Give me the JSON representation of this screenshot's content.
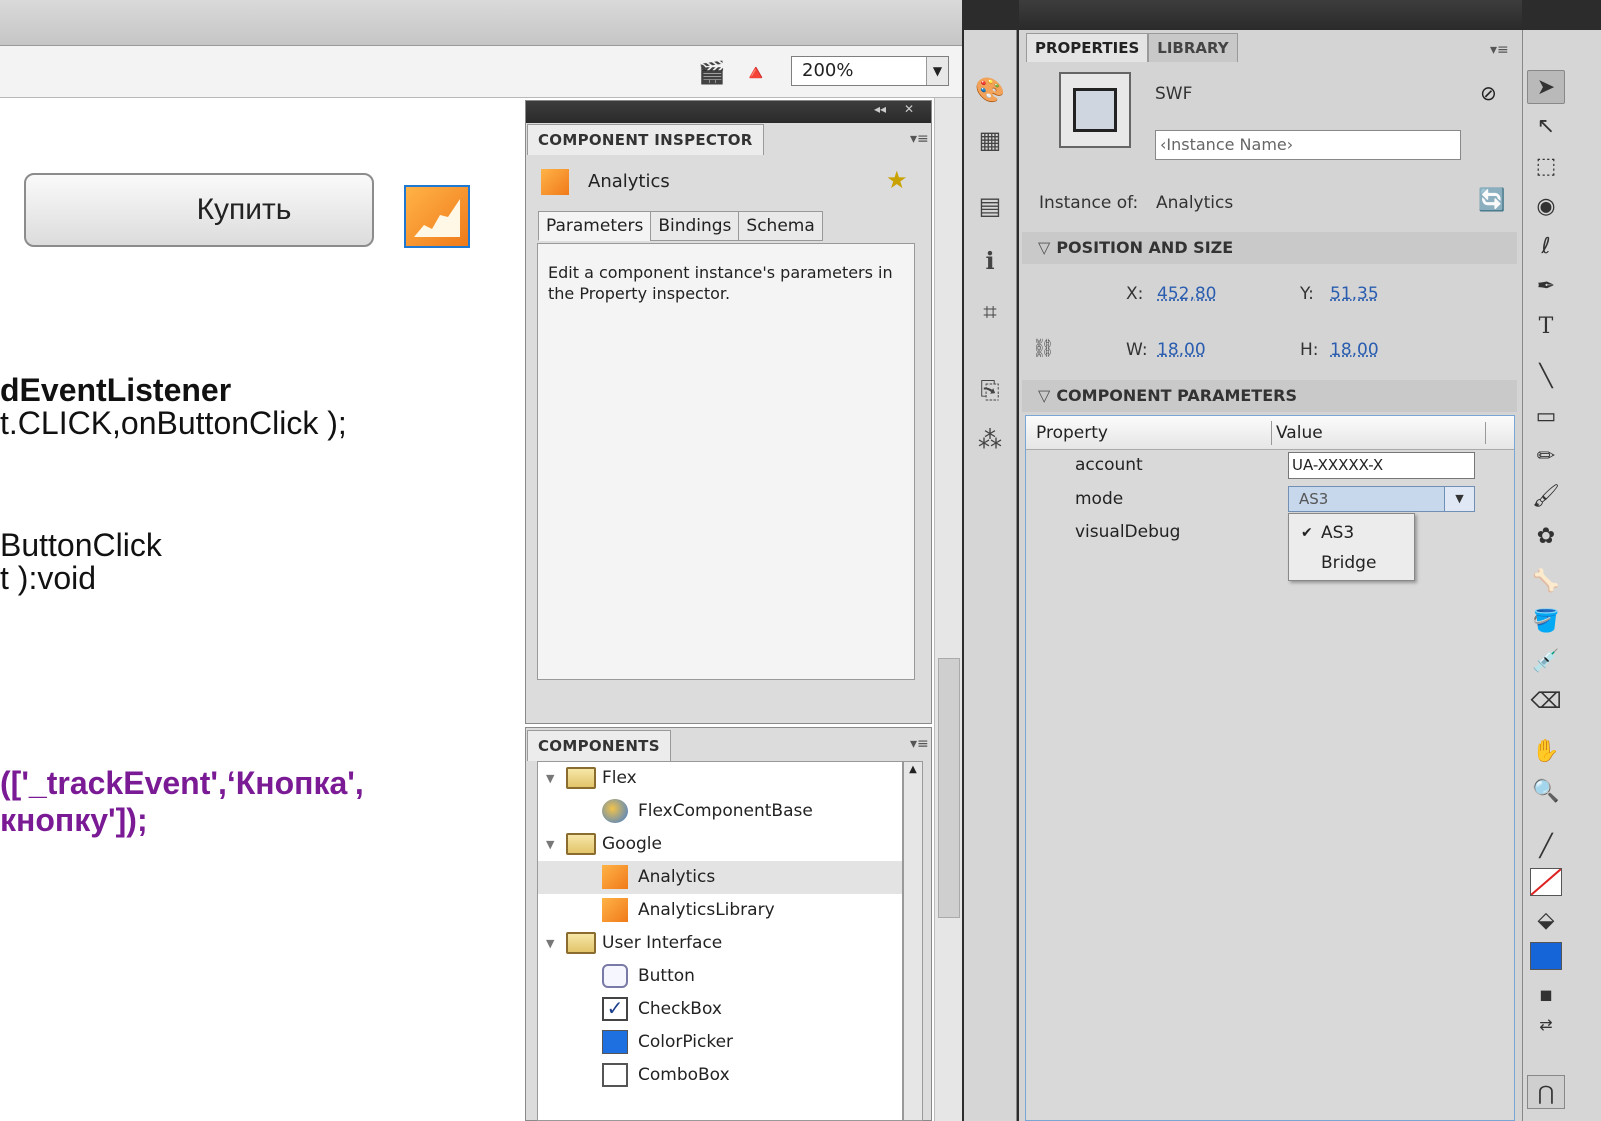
{
  "toolbar": {
    "zoom_value": "200%"
  },
  "stage": {
    "buy_button_label": "Купить",
    "code_lines": [
      "dEventListener",
      "t.CLICK,onButtonClick );",
      "ButtonClick",
      "t ):void",
      "(['_trackEvent',‘Кнопка',",
      "кнопку']);"
    ]
  },
  "component_inspector": {
    "title": "COMPONENT INSPECTOR",
    "component_name": "Analytics",
    "tabs": [
      "Parameters",
      "Bindings",
      "Schema"
    ],
    "body_text": "Edit a component instance's parameters in the Property inspector."
  },
  "components": {
    "title": "COMPONENTS",
    "tree": [
      {
        "label": "Flex",
        "type": "folder"
      },
      {
        "label": "FlexComponentBase",
        "type": "flex"
      },
      {
        "label": "Google",
        "type": "folder"
      },
      {
        "label": "Analytics",
        "type": "orange"
      },
      {
        "label": "AnalyticsLibrary",
        "type": "orange"
      },
      {
        "label": "User Interface",
        "type": "folder"
      },
      {
        "label": "Button",
        "type": "button"
      },
      {
        "label": "CheckBox",
        "type": "check"
      },
      {
        "label": "ColorPicker",
        "type": "color"
      },
      {
        "label": "ComboBox",
        "type": "combo"
      }
    ]
  },
  "properties": {
    "tabs": [
      "PROPERTIES",
      "LIBRARY"
    ],
    "symbol_type": "SWF",
    "instance_name_placeholder": "‹Instance Name›",
    "instance_of_label": "Instance of:",
    "instance_of_value": "Analytics",
    "position_section": "POSITION AND SIZE",
    "x_label": "X:",
    "x_value": "452,80",
    "y_label": "Y:",
    "y_value": "51,35",
    "w_label": "W:",
    "w_value": "18,00",
    "h_label": "H:",
    "h_value": "18,00",
    "params_section": "COMPONENT PARAMETERS",
    "grid_headers": {
      "property": "Property",
      "value": "Value"
    },
    "params": [
      {
        "name": "account",
        "value": "UA-XXXXX-X"
      },
      {
        "name": "mode",
        "value": "AS3"
      },
      {
        "name": "visualDebug",
        "value": ""
      }
    ],
    "mode_options": [
      "AS3",
      "Bridge"
    ],
    "mode_selected": "AS3"
  }
}
